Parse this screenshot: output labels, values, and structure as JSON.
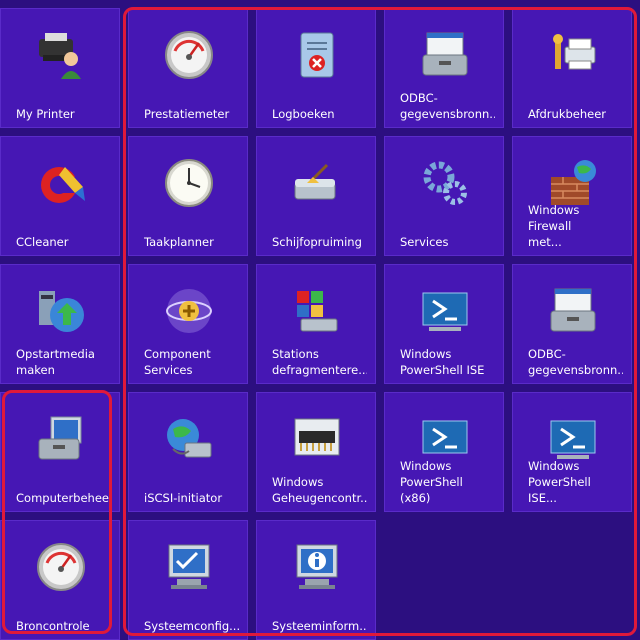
{
  "tiles": [
    {
      "name": "my-printer",
      "icon": "printer-user-icon",
      "label": "My Printer"
    },
    {
      "name": "ccleaner",
      "icon": "ccleaner-icon",
      "label": "CCleaner"
    },
    {
      "name": "opstartmedia",
      "icon": "boot-media-icon",
      "label": "Opstartmedia\nmaken"
    },
    {
      "name": "computerbeheer",
      "icon": "computer-management-icon",
      "label": "Computerbeheer"
    },
    {
      "name": "broncontrole",
      "icon": "gauge-icon",
      "label": "Broncontrole"
    },
    {
      "name": "prestatiemeter",
      "icon": "gauge-icon",
      "label": "Prestatiemeter"
    },
    {
      "name": "taakplanner",
      "icon": "clock-icon",
      "label": "Taakplanner"
    },
    {
      "name": "component-services",
      "icon": "component-services-icon",
      "label": "Component\nServices"
    },
    {
      "name": "iscsi",
      "icon": "iscsi-globe-icon",
      "label": "iSCSI-initiator"
    },
    {
      "name": "systeemconfig",
      "icon": "system-config-icon",
      "label": "Systeemconfig..."
    },
    {
      "name": "logboeken",
      "icon": "event-log-icon",
      "label": "Logboeken"
    },
    {
      "name": "schijfopruiming",
      "icon": "disk-cleanup-icon",
      "label": "Schijfopruiming"
    },
    {
      "name": "stations-defrag",
      "icon": "defrag-icon",
      "label": "Stations\ndefragmentere..."
    },
    {
      "name": "geheugen",
      "icon": "memory-chip-icon",
      "label": "Windows\nGeheugencontr..."
    },
    {
      "name": "systeeminform",
      "icon": "system-info-icon",
      "label": "Systeeminform..."
    },
    {
      "name": "odbc-1",
      "icon": "odbc-toolbox-icon",
      "label": "ODBC-\ngegevensbronn..."
    },
    {
      "name": "services",
      "icon": "gears-icon",
      "label": "Services"
    },
    {
      "name": "powershell-ise",
      "icon": "powershell-icon",
      "label": "Windows\nPowerShell ISE"
    },
    {
      "name": "powershell-x86",
      "icon": "powershell-icon",
      "label": "Windows\nPowerShell (x86)"
    },
    {
      "name": "afdrukbeheer",
      "icon": "print-management-icon",
      "label": "Afdrukbeheer"
    },
    {
      "name": "firewall",
      "icon": "firewall-icon",
      "label": "Windows Firewall\nmet..."
    },
    {
      "name": "odbc-2",
      "icon": "odbc-toolbox-icon",
      "label": "ODBC-\ngegevensbronn..."
    },
    {
      "name": "powershell-ise-x86",
      "icon": "powershell-icon",
      "label": "Windows\nPowerShell ISE..."
    }
  ],
  "colors": {
    "background": "#2c0f80",
    "tile": "#4617b4",
    "highlight": "#e0193a"
  }
}
